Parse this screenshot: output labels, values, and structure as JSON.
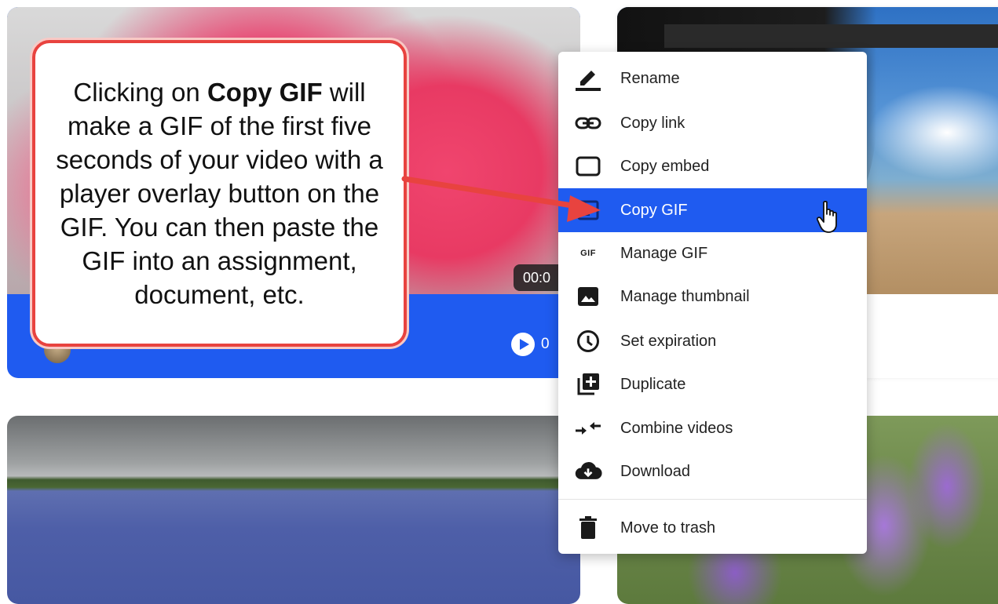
{
  "callout": {
    "line_pre": "Clicking on ",
    "bold": "Copy GIF",
    "line_post": " will make a GIF of the first five seconds of your video with a player overlay button on the GIF. You can then paste the GIF into an assignment, document, etc.",
    "border_color": "#e8433f"
  },
  "cards": [
    {
      "duration": "00:0",
      "play_count": "0",
      "footer_color": "#1f5bf0"
    }
  ],
  "menu": {
    "highlight_color": "#1f5bf0",
    "items": [
      {
        "label": "Rename",
        "icon": "pencil-icon"
      },
      {
        "label": "Copy link",
        "icon": "link-icon"
      },
      {
        "label": "Copy embed",
        "icon": "embed-icon"
      },
      {
        "label": "Copy GIF",
        "icon": "copy-gif-icon",
        "highlighted": true
      },
      {
        "label": "Manage GIF",
        "icon": "gif-icon"
      },
      {
        "label": "Manage thumbnail",
        "icon": "image-icon"
      },
      {
        "label": "Set expiration",
        "icon": "clock-icon"
      },
      {
        "label": "Duplicate",
        "icon": "duplicate-icon"
      },
      {
        "label": "Combine videos",
        "icon": "combine-icon"
      },
      {
        "label": "Download",
        "icon": "cloud-download-icon"
      },
      {
        "label": "Move to trash",
        "icon": "trash-icon"
      }
    ],
    "gif_icon_text": "GIF"
  }
}
